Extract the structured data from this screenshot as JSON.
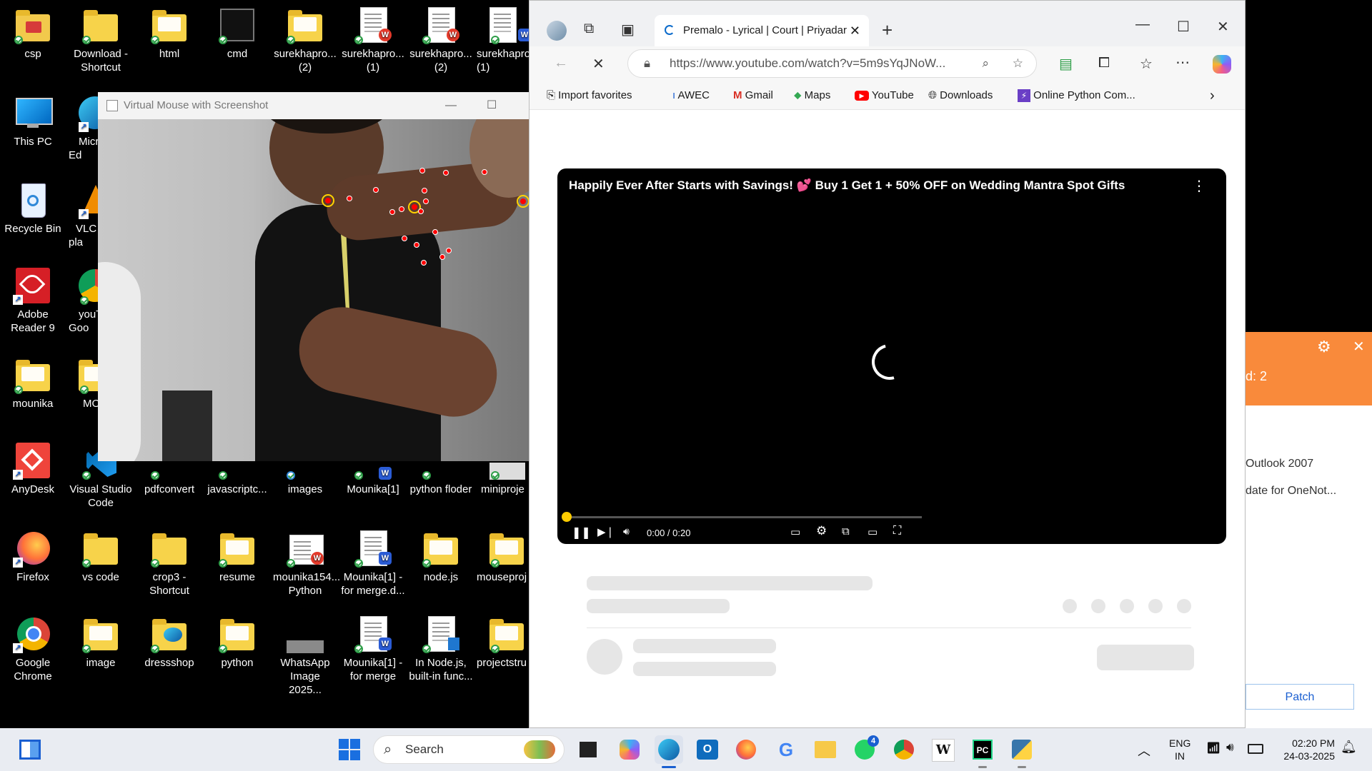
{
  "desktop": {
    "icons": [
      {
        "label": "csp",
        "type": "folder"
      },
      {
        "label": "Download - Shortcut",
        "type": "folder"
      },
      {
        "label": "html",
        "type": "folder"
      },
      {
        "label": "cmd",
        "type": "app"
      },
      {
        "label": "surekhapro... (2)",
        "type": "folder"
      },
      {
        "label": "surekhapro... (1)",
        "type": "doc"
      },
      {
        "label": "surekhapro... (2)",
        "type": "doc"
      },
      {
        "label": "surekhapro (1)",
        "type": "doc"
      },
      {
        "label": "This PC",
        "type": "app"
      },
      {
        "label": "Micr Ed",
        "type": "app"
      },
      {
        "label": "Recycle Bin",
        "type": "app"
      },
      {
        "label": "VLC pla",
        "type": "app"
      },
      {
        "label": "Adobe Reader 9",
        "type": "app"
      },
      {
        "label": "youT Goo",
        "type": "app"
      },
      {
        "label": "mounika",
        "type": "folder"
      },
      {
        "label": "MO",
        "type": "folder"
      },
      {
        "label": "AnyDesk",
        "type": "app"
      },
      {
        "label": "Visual Studio Code",
        "type": "app"
      },
      {
        "label": "pdfconvert",
        "type": "folder"
      },
      {
        "label": "javascriptc...",
        "type": "folder"
      },
      {
        "label": "images",
        "type": "folder"
      },
      {
        "label": "Mounika[1]",
        "type": "doc"
      },
      {
        "label": "python floder",
        "type": "folder"
      },
      {
        "label": "miniproje",
        "type": "folder"
      },
      {
        "label": "Firefox",
        "type": "app"
      },
      {
        "label": "vs code",
        "type": "folder"
      },
      {
        "label": "crop3 - Shortcut",
        "type": "folder"
      },
      {
        "label": "resume",
        "type": "folder"
      },
      {
        "label": "mounika154... Python",
        "type": "doc"
      },
      {
        "label": "Mounika[1] - for merge.d...",
        "type": "doc"
      },
      {
        "label": "node.js",
        "type": "folder"
      },
      {
        "label": "mouseproj",
        "type": "folder"
      },
      {
        "label": "Google Chrome",
        "type": "app"
      },
      {
        "label": "image",
        "type": "folder"
      },
      {
        "label": "dressshop",
        "type": "folder"
      },
      {
        "label": "python",
        "type": "folder"
      },
      {
        "label": "WhatsApp Image 2025...",
        "type": "image"
      },
      {
        "label": "Mounika[1] - for merge",
        "type": "doc"
      },
      {
        "label": "In Node.js, built-in func...",
        "type": "doc"
      },
      {
        "label": "projectstru",
        "type": "folder"
      }
    ]
  },
  "virtual_mouse": {
    "title": "Virtual Mouse with Screenshot",
    "minimize": "—",
    "maximize": "☐"
  },
  "browser": {
    "tab_title": "Premalo - Lyrical | Court | Priyadar",
    "tab_close": "✕",
    "new_tab": "+",
    "url": "https://www.youtube.com/watch?v=5m9sYqJNoW...",
    "favorites": [
      "Import favorites",
      "AWEC",
      "Gmail",
      "Maps",
      "YouTube",
      "Downloads",
      "Online Python Com..."
    ],
    "video": {
      "title": "Happily Ever After Starts with Savings! 💕 Buy 1 Get 1 + 50% OFF on Wedding Mantra Spot Gifts",
      "time": "0:00 / 0:20",
      "progress": 0
    }
  },
  "side_window": {
    "count_text": "d: 2",
    "item1": "Outlook 2007",
    "item2": "date for OneNot...",
    "patch_label": "Patch",
    "gear": "⚙",
    "close": "✕"
  },
  "taskbar": {
    "search_placeholder": "Search",
    "language": "ENG",
    "region": "IN",
    "time": "02:20 PM",
    "date": "24-03-2025",
    "whatsapp_badge": "4"
  },
  "colors": {
    "accent_orange": "#f98a3b",
    "youtube_red": "#ff0000",
    "progress_yellow": "#ffcc00"
  }
}
